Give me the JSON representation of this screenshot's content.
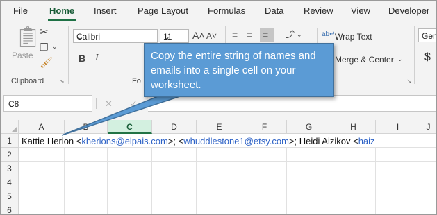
{
  "ribbon": {
    "tabs": [
      "File",
      "Home",
      "Insert",
      "Page Layout",
      "Formulas",
      "Data",
      "Review",
      "View",
      "Developer"
    ],
    "active_tab": "Home",
    "clipboard": {
      "paste_label": "Paste",
      "group_label": "Clipboard"
    },
    "font": {
      "name": "Calibri",
      "size": "11",
      "group_label": "Fo"
    },
    "alignment": {
      "wrap_text_label": "Wrap Text",
      "merge_label": "Merge & Center"
    },
    "number": {
      "format": "Gen",
      "currency_glyph": "$"
    }
  },
  "formula_bar": {
    "name_box": "C8",
    "cancel_glyph": "✕",
    "enter_glyph": "✓",
    "content": ""
  },
  "sheet": {
    "columns": [
      "A",
      "B",
      "C",
      "D",
      "E",
      "F",
      "G",
      "H",
      "I",
      "J"
    ],
    "selected_column": "C",
    "rows": [
      "1",
      "2",
      "3",
      "4",
      "5",
      "6"
    ],
    "a1_plain_1": "Kattie Herion <",
    "a1_email_1": "kherions@elpais.com",
    "a1_plain_2": ">;  <",
    "a1_email_2": "whuddlestone1@etsy.com",
    "a1_plain_3": ">; Heidi Aizikov <",
    "a1_email_3": "haiz"
  },
  "callout": {
    "text": "Copy the entire string of names and emails into a single cell on your worksheet."
  },
  "colors": {
    "accent": "#217346",
    "callout_fill": "#5b9bd5",
    "link": "#2d62c6"
  }
}
